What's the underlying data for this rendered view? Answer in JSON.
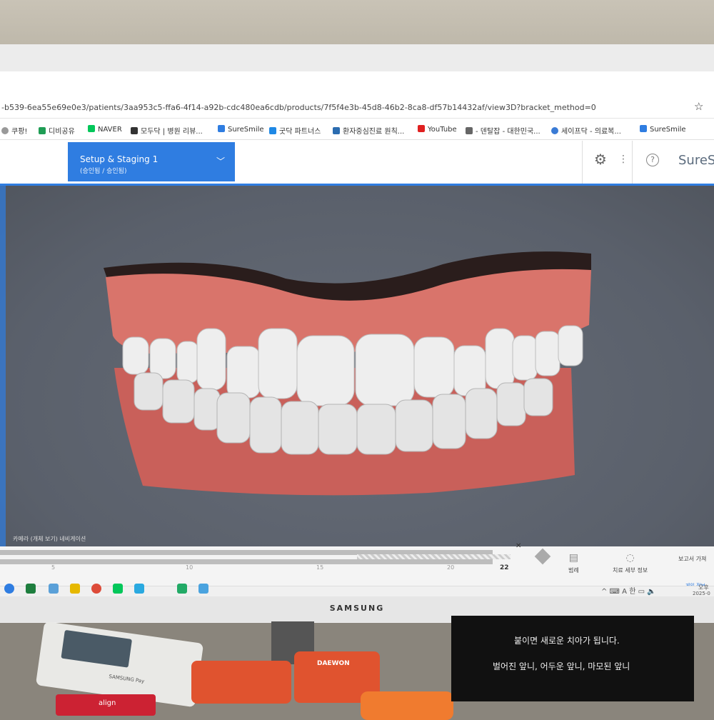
{
  "browser": {
    "url": "-b539-6ea55e69e0e3/patients/3aa953c5-ffa6-4f14-a92b-cdc480ea6cdb/products/7f5f4e3b-45d8-46b2-8ca8-df57b14432af/view3D?bracket_method=0",
    "bookmarks": [
      "쿠팡!",
      "디비공유",
      "NAVER",
      "모두닥 | 병원 리뷰...",
      "SureSmile",
      "굿닥 파트너스",
      "환자중심진료 원칙...",
      "YouTube",
      "- 덴탈잡 - 대한민국...",
      "세이프닥 - 의료복...",
      "SureSmile"
    ]
  },
  "app": {
    "stage_title": "Setup & Staging 1",
    "stage_subtitle": "(승인됨 / 승인됨)",
    "logo": "SureS",
    "caption": "카메라 (개체 보기) 네비게이션"
  },
  "timeline": {
    "ticks": [
      "5",
      "10",
      "15",
      "20"
    ],
    "current": "22",
    "buttons": [
      "범례",
      "치료 세부 정보",
      "보고서 가져"
    ],
    "badge": "게인 정보"
  },
  "taskbar": {
    "tray_text": "오후",
    "date": "2025-0"
  },
  "monitor": {
    "brand": "SAMSUNG"
  },
  "desk": {
    "pad_label": "SAMSUNG Pay",
    "case_label": "DAEWON",
    "align_label": "align",
    "sign_line1": "붙이면 새로운 치아가 됩니다.",
    "sign_line2": "벌어진 앞니, 어두운 앞니, 마모된 앞니"
  },
  "colors": {
    "accent": "#2f7de1",
    "gum": "#d96f66",
    "tooth": "#efefef"
  }
}
